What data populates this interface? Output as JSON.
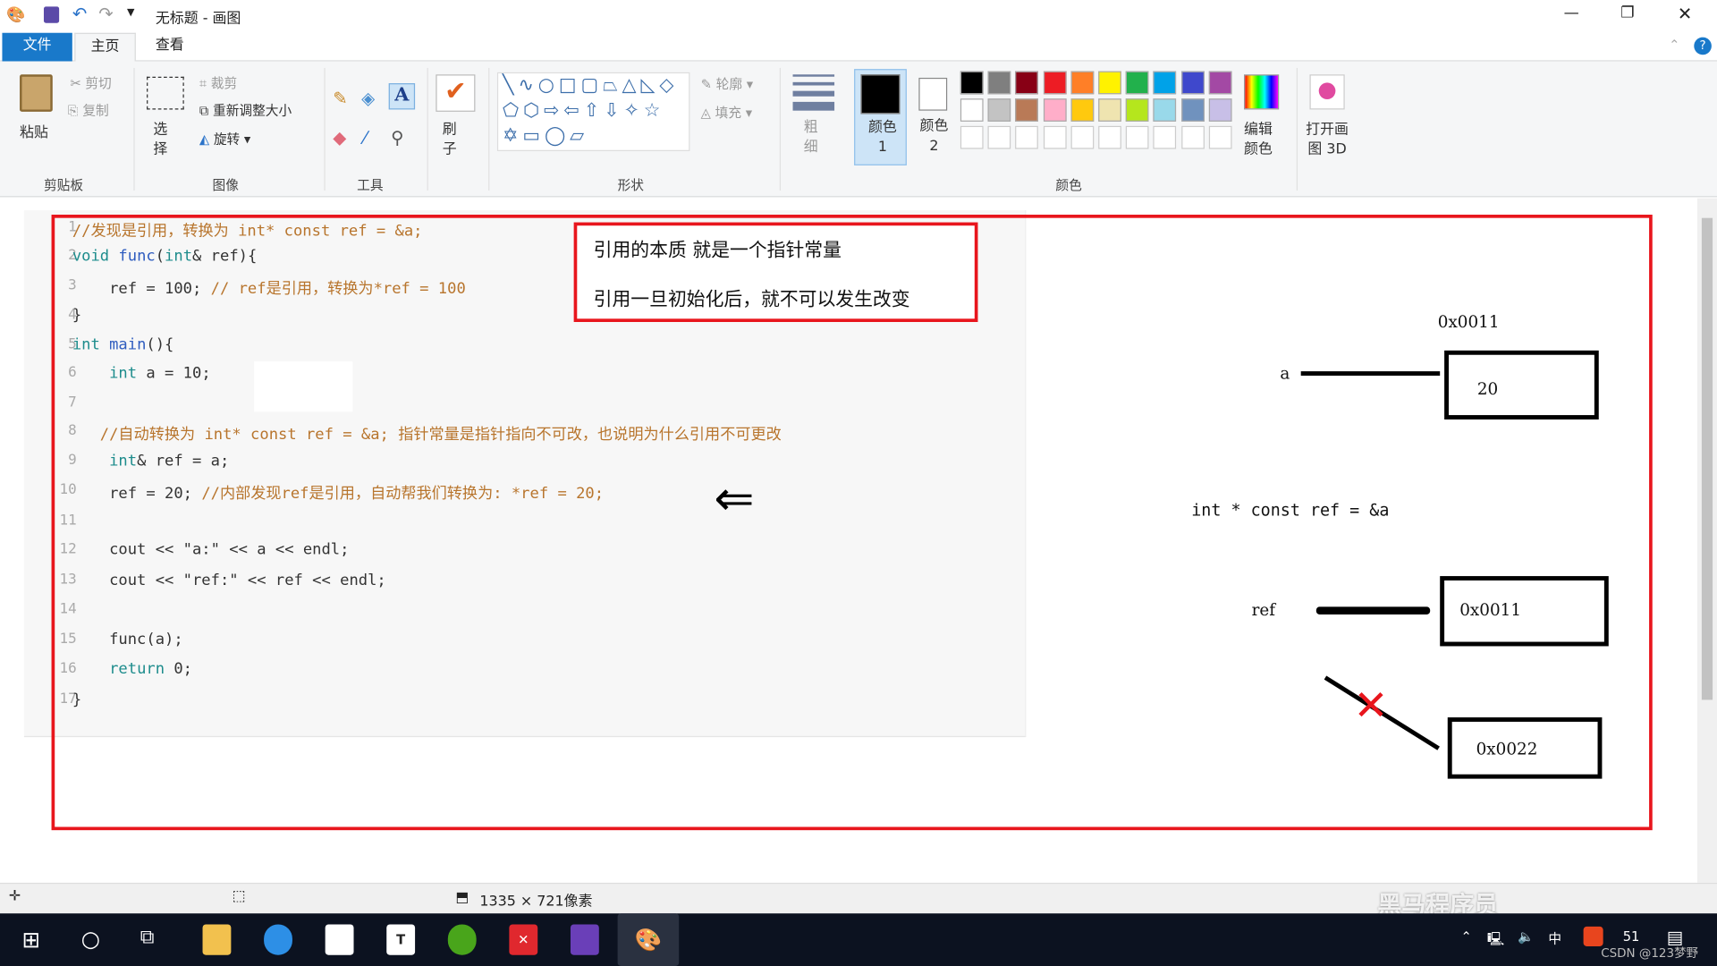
{
  "window": {
    "title": "无标题 - 画图",
    "controls": {
      "minimize": "—",
      "restore": "❐",
      "close": "✕"
    }
  },
  "menu_tabs": [
    {
      "label": "文件"
    },
    {
      "label": "主页"
    },
    {
      "label": "查看"
    }
  ],
  "ribbon": {
    "clipboard": {
      "label": "剪贴板",
      "paste": "粘贴",
      "cut": "剪切",
      "copy": "复制"
    },
    "image": {
      "label": "图像",
      "select": "选择",
      "crop": "裁剪",
      "resize": "重新调整大小",
      "rotate": "旋转"
    },
    "tools": {
      "label": "工具"
    },
    "brushes": {
      "label": "刷子"
    },
    "shapes": {
      "label": "形状",
      "outline": "轮廓",
      "fill": "填充",
      "glyphs": "╲∿○□▢⏢△◺◇⬠⬡⇨⇦⇧⇩✧☆✡▭◯▱"
    },
    "size": {
      "label": "粗细"
    },
    "colors": {
      "label": "颜色",
      "color1": "颜色 1",
      "color2": "颜色 2",
      "edit": "编辑颜色",
      "paint3d": "打开画图 3D",
      "palette": [
        "#000000",
        "#7f7f7f",
        "#880015",
        "#ed1c24",
        "#ff7f27",
        "#fff200",
        "#22b14c",
        "#00a2e8",
        "#3f48cc",
        "#a349a4",
        "#ffffff",
        "#c3c3c3",
        "#b97a57",
        "#ffaec9",
        "#ffc90e",
        "#efe4b0",
        "#b5e61d",
        "#99d9ea",
        "#7092be",
        "#c8bfe7"
      ]
    }
  },
  "code": {
    "lines": [
      [
        [
          "cmt",
          "//发现是引用，转换为 int* const ref = &a;"
        ]
      ],
      [
        [
          "kw",
          "void "
        ],
        [
          "fn",
          "func"
        ],
        [
          "",
          "("
        ],
        [
          "kw",
          "int"
        ],
        [
          "",
          "& ref){"
        ]
      ],
      [
        [
          "",
          "    ref = 100; "
        ],
        [
          "cmt",
          "// ref是引用，转换为*ref = 100"
        ]
      ],
      [
        [
          "",
          "}"
        ]
      ],
      [
        [
          "kw",
          "int "
        ],
        [
          "fn",
          "main"
        ],
        [
          "",
          "(){"
        ]
      ],
      [
        [
          "",
          "    "
        ],
        [
          "kw",
          "int"
        ],
        [
          "",
          " a = 10;"
        ]
      ],
      [
        [
          "",
          ""
        ]
      ],
      [
        [
          "cmt",
          "   //自动转换为 int* const ref = &a; 指针常量是指针指向不可改，也说明为什么引用不可更改"
        ]
      ],
      [
        [
          "",
          "    "
        ],
        [
          "kw",
          "int"
        ],
        [
          "",
          "& ref = a;"
        ]
      ],
      [
        [
          "",
          "    ref = 20; "
        ],
        [
          "cmt",
          "//内部发现ref是引用，自动帮我们转换为: *ref = 20;"
        ]
      ],
      [
        [
          "",
          ""
        ]
      ],
      [
        [
          "",
          "    cout << \"a:\" << a << endl;"
        ]
      ],
      [
        [
          "",
          "    cout << \"ref:\" << ref << endl;"
        ]
      ],
      [
        [
          "",
          ""
        ]
      ],
      [
        [
          "",
          "    func(a);"
        ]
      ],
      [
        [
          "",
          "    "
        ],
        [
          "kw",
          "return"
        ],
        [
          "",
          " 0;"
        ]
      ],
      [
        [
          "",
          "}"
        ]
      ]
    ]
  },
  "notes": {
    "line1": "引用的本质 就是一个指针常量",
    "line2": "引用一旦初始化后，就不可以发生改变"
  },
  "diagram": {
    "addr_label": "0x0011",
    "var_a": "a",
    "box_a": "20",
    "expr": "int * const ref = &a",
    "var_ref": "ref",
    "box_ref": "0x0011",
    "box_other": "0x0022",
    "cross": "✕",
    "arrow": "⇐"
  },
  "status": {
    "dimensions": "1335 × 721像素"
  },
  "watermark": {
    "text": "黑马程序员",
    "credit": "CSDN @123梦野"
  },
  "tray": {
    "ime": "中",
    "clock": "51"
  }
}
